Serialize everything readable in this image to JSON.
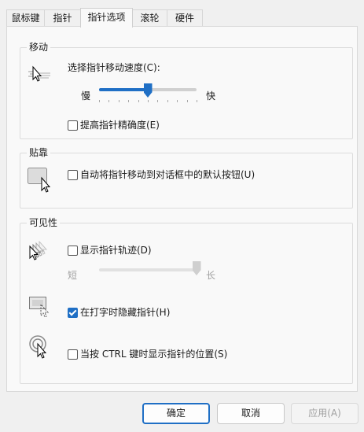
{
  "tabs": [
    "鼠标键",
    "指针",
    "指针选项",
    "滚轮",
    "硬件"
  ],
  "active_tab": "指针选项",
  "motion": {
    "title": "移动",
    "speed_label": "选择指针移动速度(C):",
    "slow": "慢",
    "fast": "快",
    "speed_value": 0.5,
    "enhance_label": "提高指针精确度(E)",
    "enhance_checked": false
  },
  "snap": {
    "title": "贴靠",
    "snap_label": "自动将指针移动到对话框中的默认按钮(U)",
    "snap_checked": false
  },
  "visibility": {
    "title": "可见性",
    "trails_label": "显示指针轨迹(D)",
    "trails_checked": false,
    "short": "短",
    "long": "长",
    "trails_value": 1.0,
    "hide_label": "在打字时隐藏指针(H)",
    "hide_checked": true,
    "ctrl_label": "当按 CTRL 键时显示指针的位置(S)",
    "ctrl_checked": false
  },
  "buttons": {
    "ok": "确定",
    "cancel": "取消",
    "apply": "应用(A)"
  },
  "icons": {
    "motion": "pointer-speed-icon",
    "snap": "snap-to-icon",
    "trails": "pointer-trails-icon",
    "hide": "hide-pointer-icon",
    "ctrl": "pointer-location-icon"
  },
  "colors": {
    "accent": "#1f6fc5"
  }
}
